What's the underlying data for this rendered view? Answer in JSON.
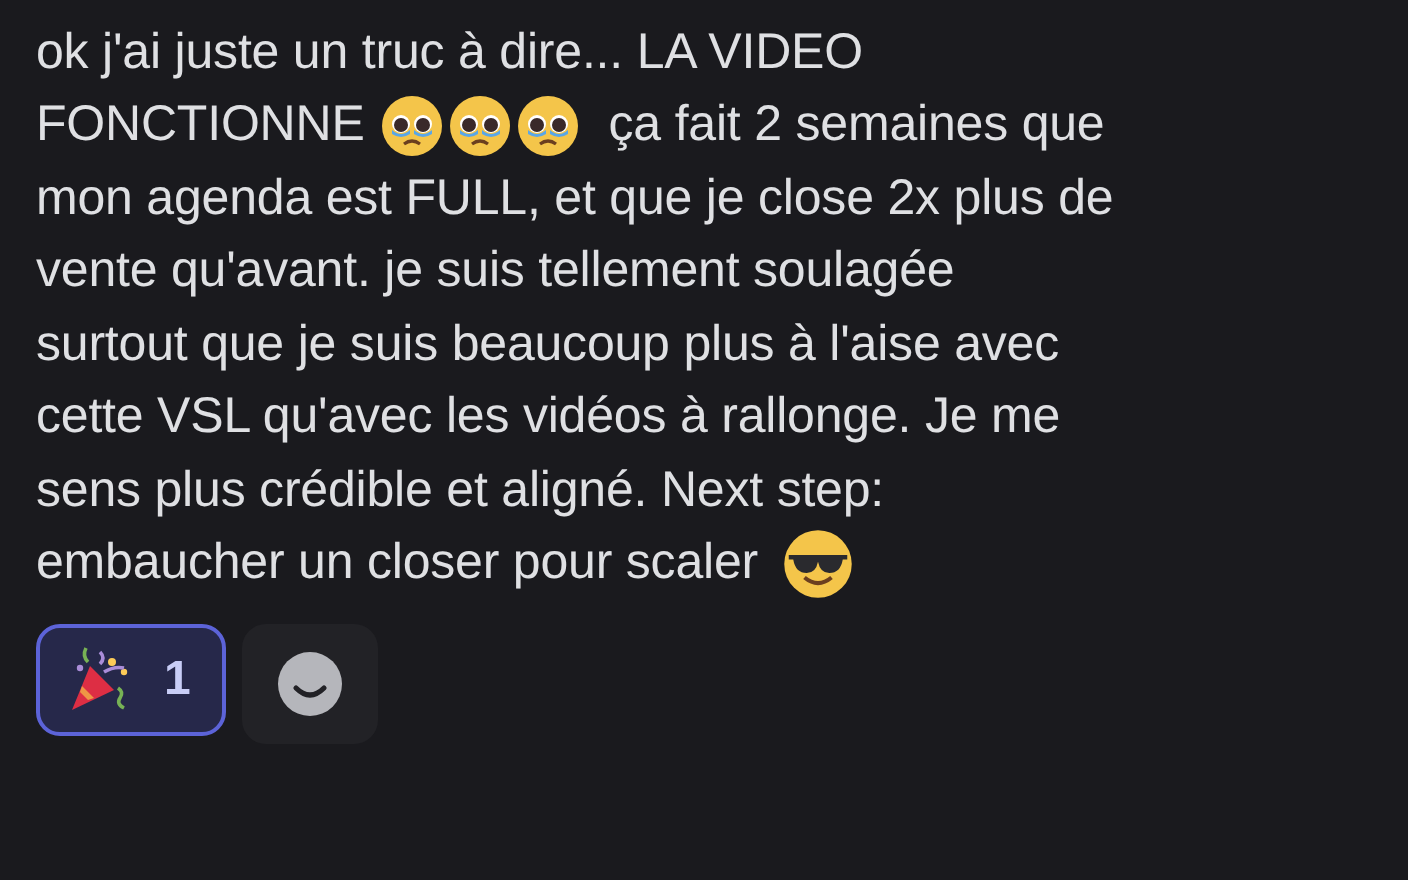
{
  "message": {
    "lines": [
      [
        {
          "kind": "text",
          "text": "ok j'ai juste un truc à dire... LA VIDEO"
        }
      ],
      [
        {
          "kind": "text",
          "text": "FONCTIONNE"
        },
        {
          "kind": "pleading"
        },
        {
          "kind": "pleading"
        },
        {
          "kind": "pleading"
        },
        {
          "kind": "text",
          "text": "ça fait 2 semaines que"
        }
      ],
      [
        {
          "kind": "text",
          "text": "mon agenda est FULL, et que je close 2x plus de"
        }
      ],
      [
        {
          "kind": "text",
          "text": "vente qu'avant. je suis tellement soulagée"
        }
      ],
      [
        {
          "kind": "text",
          "text": "surtout que je suis beaucoup plus à l'aise avec"
        }
      ],
      [
        {
          "kind": "text",
          "text": "cette VSL qu'avec les vidéos à rallonge. Je me"
        }
      ],
      [
        {
          "kind": "text",
          "text": "sens plus crédible et aligné. Next step:"
        }
      ],
      [
        {
          "kind": "text",
          "text": "embaucher un closer pour scaler"
        },
        {
          "kind": "cool"
        }
      ]
    ]
  },
  "reactions": [
    {
      "kind": "party",
      "count": "1",
      "selected": true
    }
  ]
}
